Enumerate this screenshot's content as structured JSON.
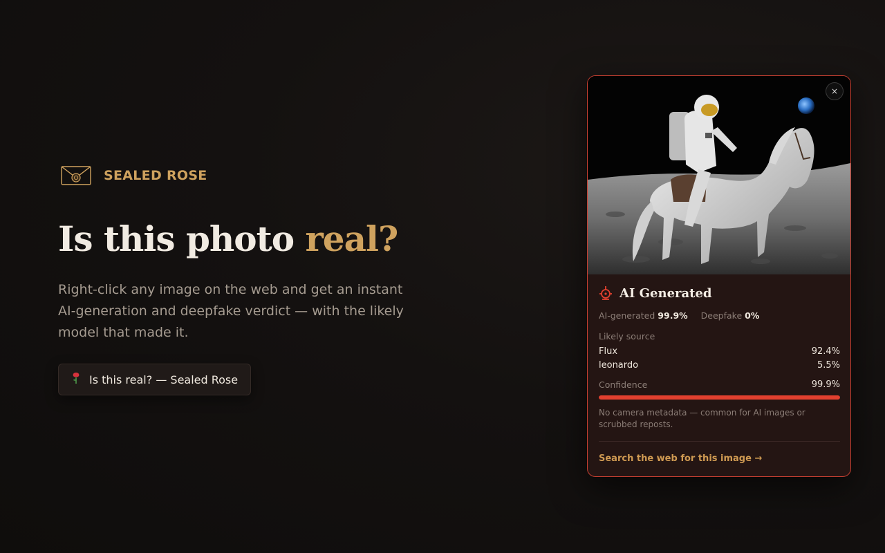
{
  "brand": {
    "name": "SEALED ROSE",
    "icon": "envelope-seal-icon",
    "color": "#cfa25e"
  },
  "hero": {
    "headline_main": "Is this photo ",
    "headline_accent": "real?",
    "subtitle": "Right-click any image on the web and get an instant AI-generation and deepfake verdict — with the likely model that made it.",
    "cta_icon": "rose-icon",
    "cta_label": "Is this real? — Sealed Rose"
  },
  "card": {
    "close_label": "×",
    "image": "astronaut-riding-horse-on-moon",
    "verdict_icon": "alert-icon",
    "verdict": "AI Generated",
    "ai_generated_label": "AI-generated",
    "ai_generated_value": "99.9%",
    "deepfake_label": "Deepfake",
    "deepfake_value": "0%",
    "likely_source_label": "Likely source",
    "sources": [
      {
        "name": "Flux",
        "value": "92.4%"
      },
      {
        "name": "leonardo",
        "value": "5.5%"
      }
    ],
    "confidence_label": "Confidence",
    "confidence_value": "99.9%",
    "confidence_fraction": 0.999,
    "note": "No camera metadata — common for AI images or scrubbed reposts.",
    "search_link": "Search the web for this image →",
    "accent_color": "#e2402f",
    "border_color": "#c63f31"
  }
}
